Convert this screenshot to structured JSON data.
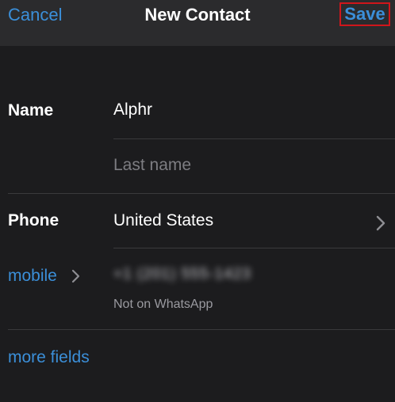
{
  "nav": {
    "cancel_label": "Cancel",
    "title": "New Contact",
    "save_label": "Save"
  },
  "name_section": {
    "label": "Name",
    "first_name_value": "Alphr",
    "last_name_placeholder": "Last name"
  },
  "phone_section": {
    "label": "Phone",
    "country_value": "United States",
    "type_label": "mobile",
    "number_value": "+1 (201) 555-1423",
    "whatsapp_status": "Not on WhatsApp"
  },
  "more_fields_label": "more fields",
  "colors": {
    "accent": "#3b8fd9",
    "background": "#1c1c1e",
    "nav_background": "#2b2b2d",
    "highlight_border": "#d0161b"
  }
}
